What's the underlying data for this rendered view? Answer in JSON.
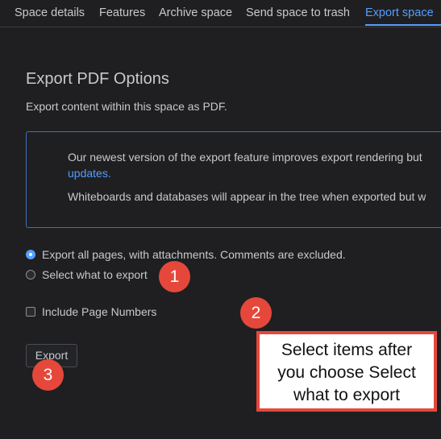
{
  "tabs": [
    {
      "label": "Space details",
      "active": false
    },
    {
      "label": "Features",
      "active": false
    },
    {
      "label": "Archive space",
      "active": false
    },
    {
      "label": "Send space to trash",
      "active": false
    },
    {
      "label": "Export space",
      "active": true
    }
  ],
  "main": {
    "heading": "Export PDF Options",
    "description": "Export content within this space as PDF.",
    "notice": {
      "line1": "Our newest version of the export feature improves export rendering but",
      "link": "updates.",
      "line3": "Whiteboards and databases will appear in the tree when exported but w"
    },
    "options": {
      "all_pages": {
        "label": "Export all pages, with attachments. Comments are excluded.",
        "selected": true
      },
      "select_what": {
        "label": "Select what to export",
        "selected": false
      }
    },
    "include_page_numbers": {
      "label": "Include Page Numbers",
      "checked": false
    },
    "export_button": "Export"
  },
  "annotations": {
    "badge1": "1",
    "badge2": "2",
    "badge3": "3",
    "callout_lines": [
      "Select items after",
      "you choose Select",
      "what to export"
    ]
  },
  "colors": {
    "background": "#1f1f21",
    "accent": "#579dff",
    "annotation": "#e5483b"
  }
}
